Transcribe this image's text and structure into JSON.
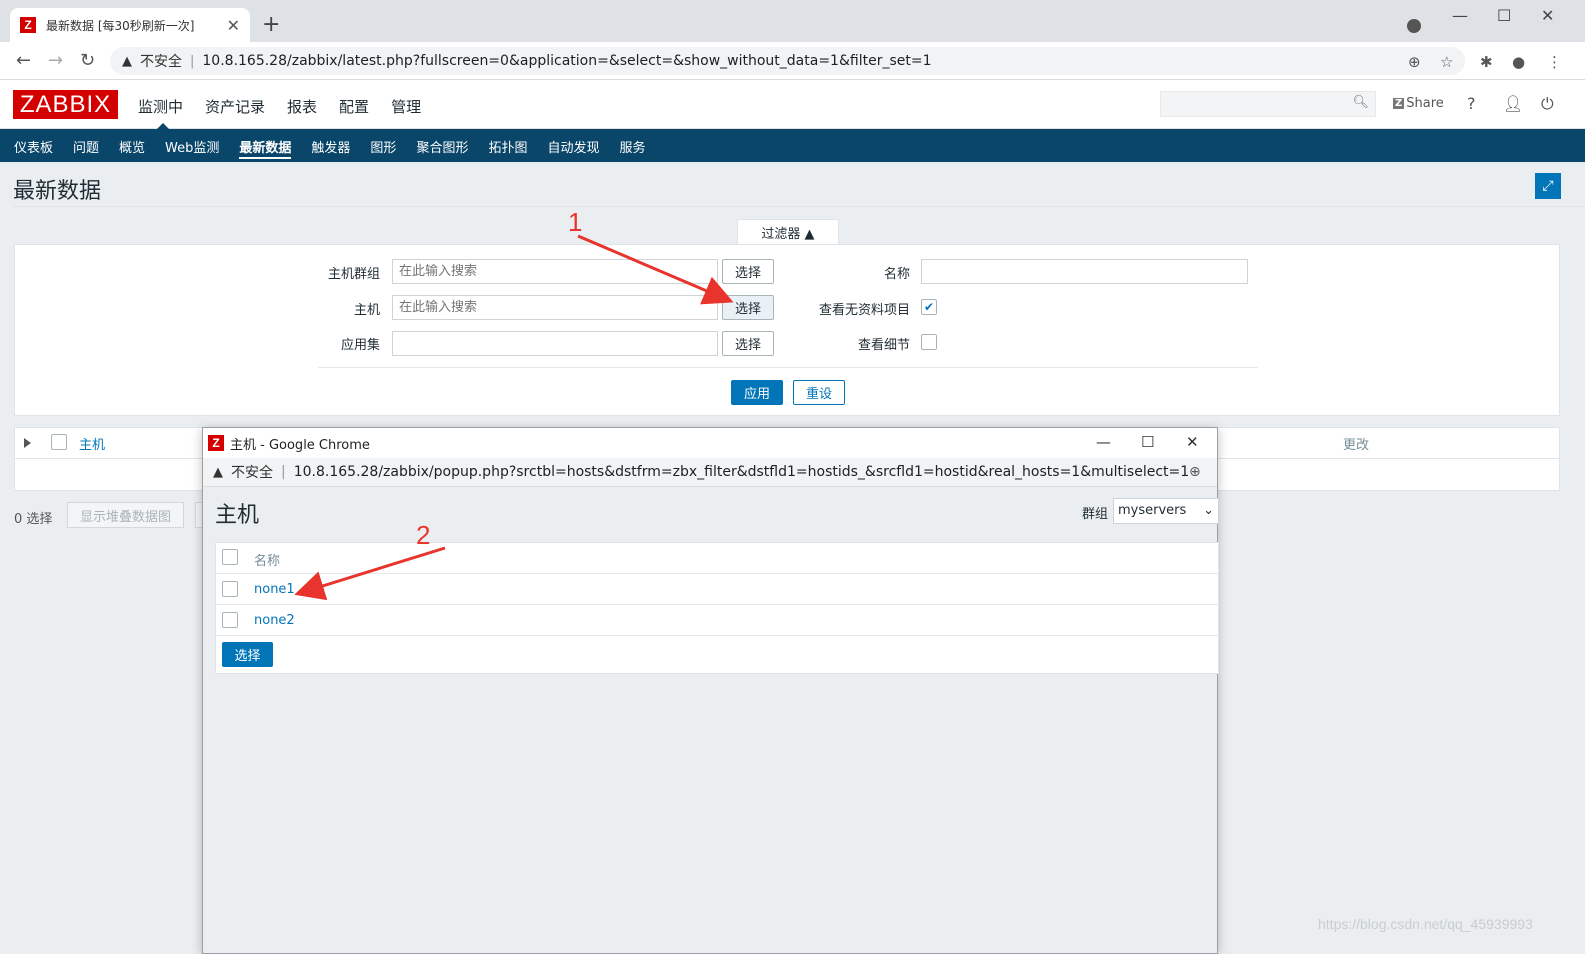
{
  "browser": {
    "tab_title": "最新数据 [每30秒刷新一次]",
    "insecure_label": "不安全",
    "url": "10.8.165.28/zabbix/latest.php?fullscreen=0&application=&select=&show_without_data=1&filter_set=1"
  },
  "header": {
    "logo": "ZABBIX",
    "menu": [
      "监测中",
      "资产记录",
      "报表",
      "配置",
      "管理"
    ],
    "share_label": "Share",
    "help_label": "?"
  },
  "submenu": [
    "仪表板",
    "问题",
    "概览",
    "Web监测",
    "最新数据",
    "触发器",
    "图形",
    "聚合图形",
    "拓扑图",
    "自动发现",
    "服务"
  ],
  "page_title": "最新数据",
  "filter": {
    "tab_label": "过滤器 ▲",
    "host_group_label": "主机群组",
    "host_label": "主机",
    "application_label": "应用集",
    "placeholder": "在此输入搜索",
    "select_label": "选择",
    "name_label": "名称",
    "show_without_data_label": "查看无资料项目",
    "show_details_label": "查看细节",
    "apply_label": "应用",
    "reset_label": "重设"
  },
  "table": {
    "col_host": "主机",
    "col_change": "更改",
    "selected_count": "0 选择",
    "stacked_graph_label": "显示堆叠数据图"
  },
  "popup": {
    "window_title": "主机 - Google Chrome",
    "insecure_label": "不安全",
    "url": "10.8.165.28/zabbix/popup.php?srctbl=hosts&dstfrm=zbx_filter&dstfld1=hostids_&srcfld1=hostid&real_hosts=1&multiselect=1",
    "heading": "主机",
    "group_label": "群组",
    "group_value": "myservers",
    "col_name": "名称",
    "rows": [
      "none1",
      "none2"
    ],
    "select_label": "选择"
  },
  "annotations": [
    "1",
    "2"
  ],
  "watermark": "https://blog.csdn.net/qq_45939993",
  "colors": {
    "brand": "#d40000",
    "nav": "#0a466a",
    "primary": "#0275b8",
    "annotation": "#e8342c"
  }
}
